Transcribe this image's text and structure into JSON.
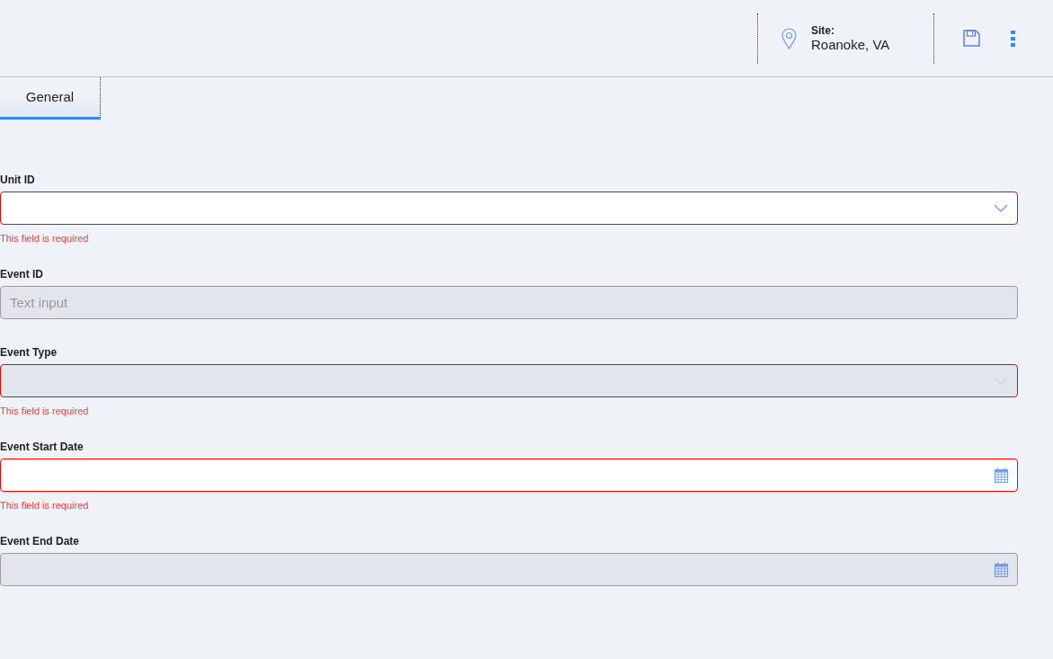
{
  "header": {
    "site_label": "Site:",
    "site_value": "Roanoke, VA"
  },
  "tabs": [
    {
      "label": "General",
      "selected": true
    }
  ],
  "fields": [
    {
      "label": "Unit ID",
      "kind": "select",
      "disabled": false,
      "error": "This field is required"
    },
    {
      "label": "Event ID",
      "kind": "text",
      "disabled": true,
      "placeholder": "Text input"
    },
    {
      "label": "Event Type",
      "kind": "select",
      "disabled": true,
      "error": "This field is required"
    },
    {
      "label": "Event Start Date",
      "kind": "date",
      "disabled": false,
      "error": "This field is required"
    },
    {
      "label": "Event End Date",
      "kind": "date",
      "disabled": true
    }
  ]
}
